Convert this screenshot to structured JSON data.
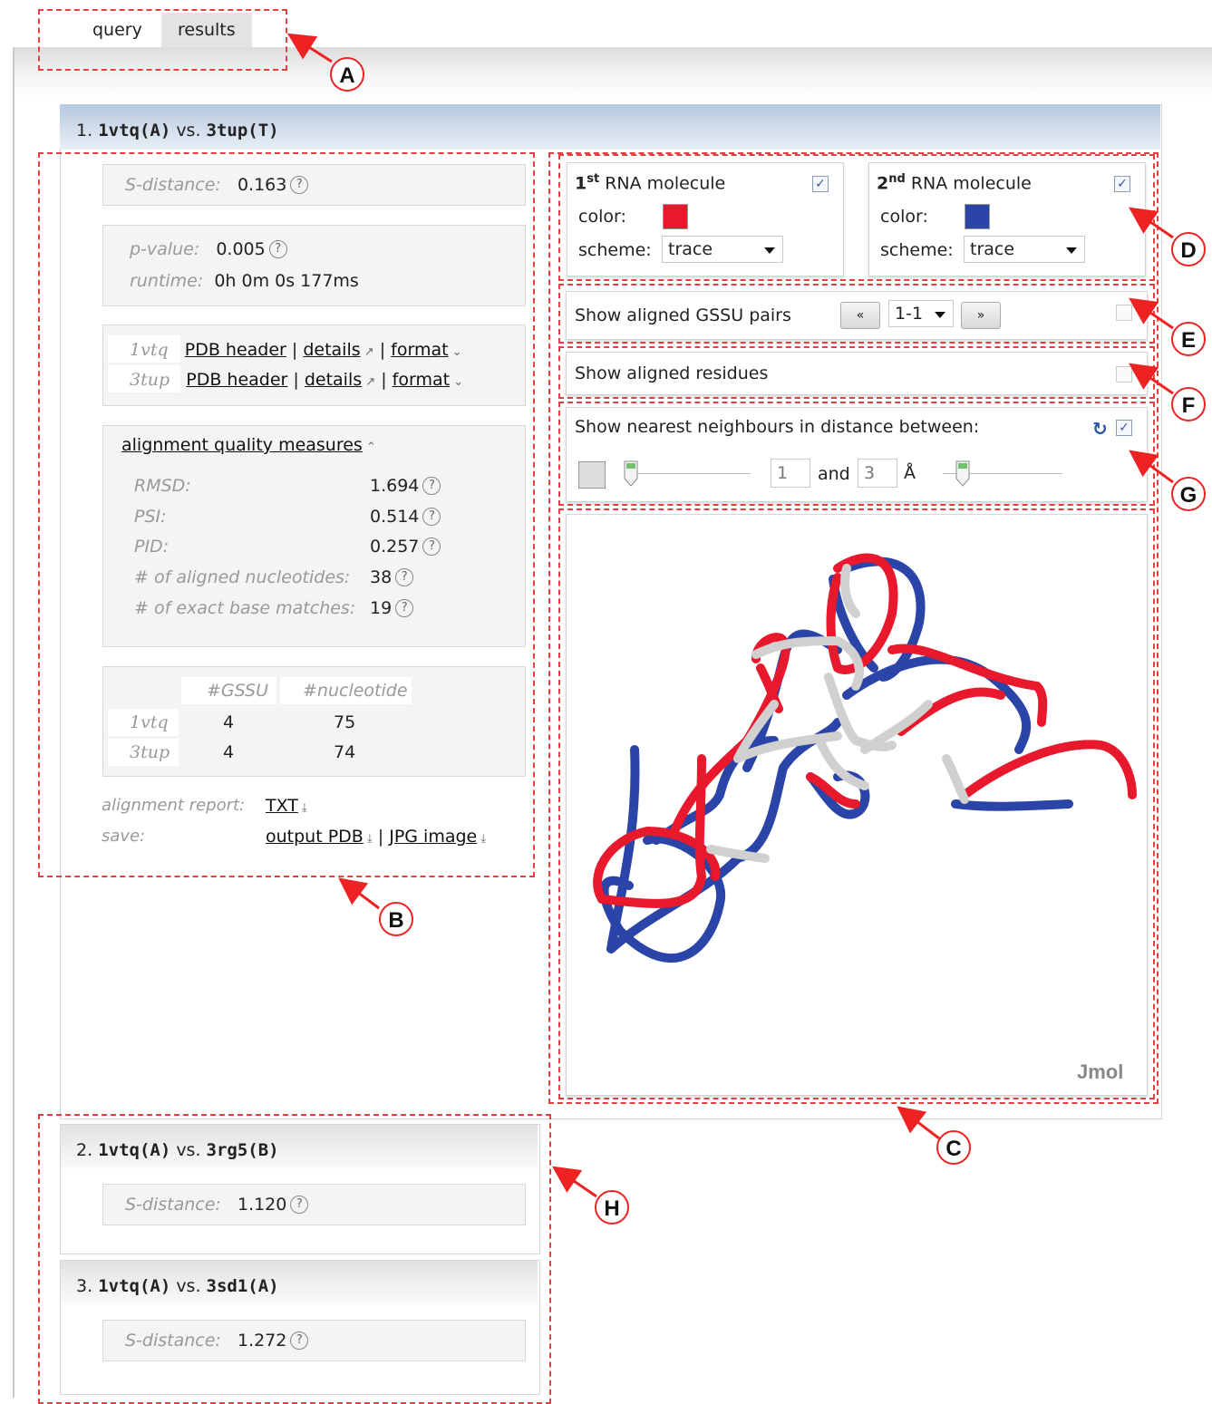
{
  "tabs": [
    {
      "label": "query"
    },
    {
      "label": "results"
    }
  ],
  "result1": {
    "num": "1.",
    "left": "1vtq(A)",
    "vs": "vs.",
    "right": "3tup(T)",
    "s_distance_label": "S-distance:",
    "s_distance": "0.163",
    "pvalue_label": "p-value:",
    "pvalue": "0.005",
    "runtime_label": "runtime:",
    "runtime": "0h 0m 0s 177ms",
    "molecules": [
      {
        "id": "1vtq",
        "pdb_header": "PDB header",
        "details": "details",
        "format": "format"
      },
      {
        "id": "3tup",
        "pdb_header": "PDB header",
        "details": "details",
        "format": "format"
      }
    ],
    "quality": {
      "title": "alignment quality measures",
      "rows": [
        {
          "label": "RMSD:",
          "value": "1.694"
        },
        {
          "label": "PSI:",
          "value": "0.514"
        },
        {
          "label": "PID:",
          "value": "0.257"
        },
        {
          "label": "# of aligned nucleotides:",
          "value": "38"
        },
        {
          "label": "# of exact base matches:",
          "value": "19"
        }
      ]
    },
    "counts": {
      "headers": [
        "#GSSU",
        "#nucleotide"
      ],
      "rows": [
        {
          "id": "1vtq",
          "gssu": "4",
          "nuc": "75"
        },
        {
          "id": "3tup",
          "gssu": "4",
          "nuc": "74"
        }
      ]
    },
    "report_label": "alignment report:",
    "report_link": "TXT",
    "save_label": "save:",
    "save_pdb": "output PDB",
    "save_jpg": "JPG image"
  },
  "viewer": {
    "mol1": {
      "sup": "st",
      "num": "1",
      "title": "RNA molecule",
      "color_label": "color:",
      "color": "#e8192c",
      "scheme_label": "scheme:",
      "scheme": "trace"
    },
    "mol2": {
      "sup": "nd",
      "num": "2",
      "title": "RNA molecule",
      "color_label": "color:",
      "color": "#2a44a8",
      "scheme_label": "scheme:",
      "scheme": "trace"
    },
    "gssu_label": "Show aligned GSSU pairs",
    "gssu_prev": "«",
    "gssu_sel": "1-1",
    "gssu_next": "»",
    "residues_label": "Show aligned residues",
    "neighbours_label": "Show nearest neighbours in distance between:",
    "dist_min": "1",
    "and_label": "and",
    "dist_max": "3",
    "unit": "Å",
    "jmol_label": "Jmol"
  },
  "others": [
    {
      "num": "2.",
      "left": "1vtq(A)",
      "vs": "vs.",
      "right": "3rg5(B)",
      "s_label": "S-distance:",
      "s": "1.120"
    },
    {
      "num": "3.",
      "left": "1vtq(A)",
      "vs": "vs.",
      "right": "3sd1(A)",
      "s_label": "S-distance:",
      "s": "1.272"
    }
  ],
  "callouts": [
    "A",
    "B",
    "C",
    "D",
    "E",
    "F",
    "G",
    "H"
  ],
  "colors": {
    "red": "#e8192c",
    "blue": "#2a44a8",
    "annotation": "#e22222"
  }
}
